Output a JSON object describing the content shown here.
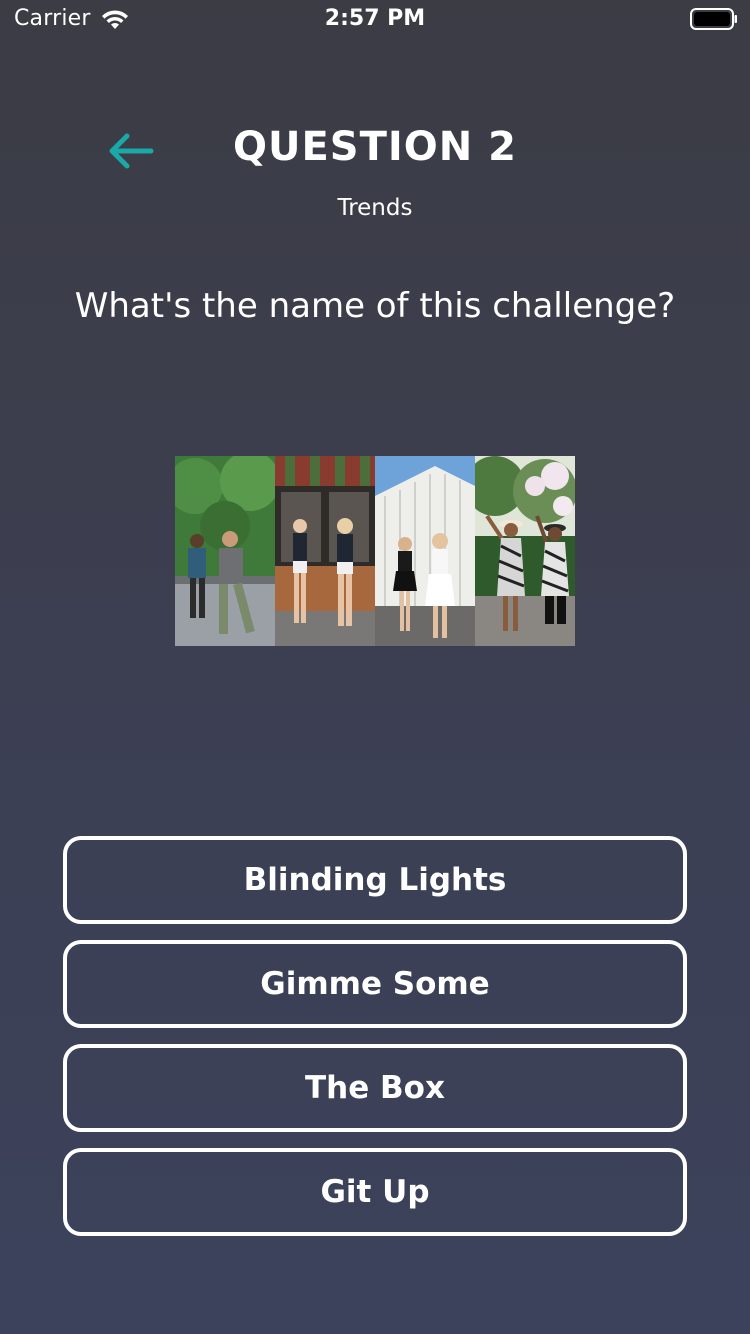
{
  "status_bar": {
    "carrier": "Carrier",
    "time": "2:57 PM"
  },
  "header": {
    "title": "QUESTION 2",
    "category": "Trends",
    "back_icon": "arrow-left-icon",
    "accent_color": "#1aa8a8"
  },
  "question": {
    "text": "What's the name of this challenge?"
  },
  "image": {
    "panels": 4,
    "description_icon": "challenge-photo-collage"
  },
  "answers": [
    {
      "label": "Blinding Lights"
    },
    {
      "label": "Gimme Some"
    },
    {
      "label": "The Box"
    },
    {
      "label": "Git Up"
    }
  ]
}
